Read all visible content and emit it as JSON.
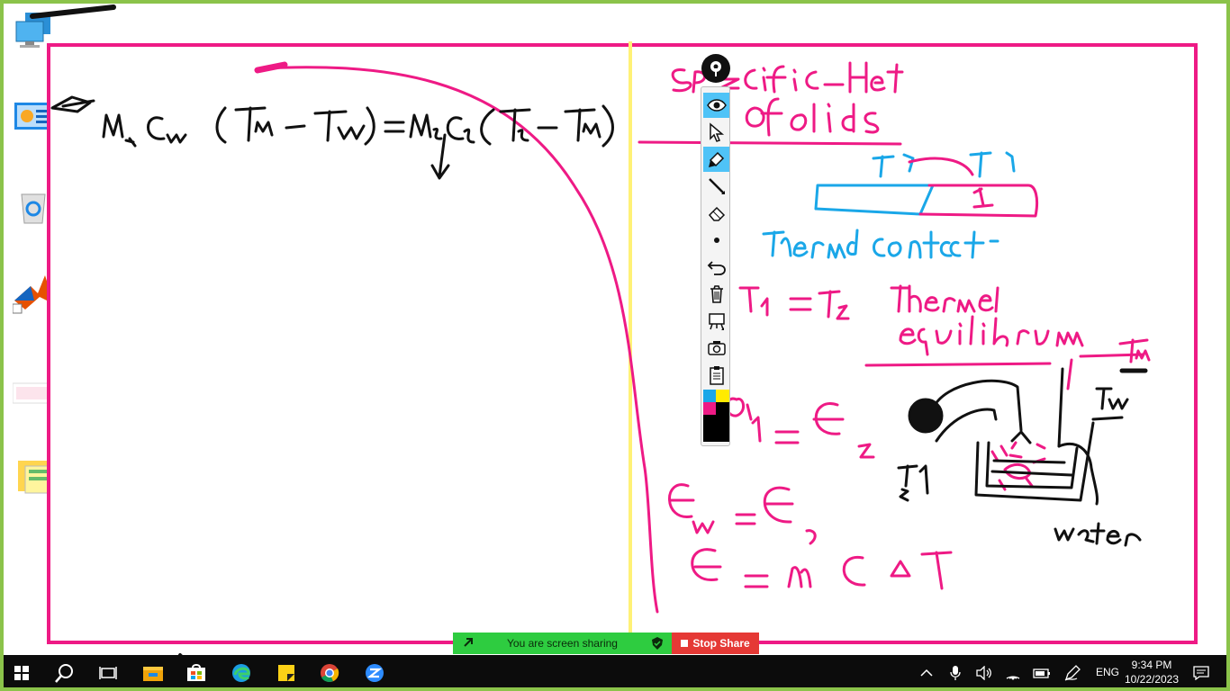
{
  "toolbar": {
    "tools": [
      "pin-icon",
      "eye-icon",
      "pointer-icon",
      "highlighter-icon",
      "line-icon",
      "eraser-icon",
      "dot-icon",
      "undo-icon",
      "trash-icon",
      "whiteboard-icon",
      "camera-icon",
      "clipboard-icon",
      "color-palette-icon"
    ],
    "colors": [
      "#1aa7e8",
      "#ffeb00",
      "#ee1a85",
      "#000000"
    ]
  },
  "share_bar": {
    "status_text": "You are screen sharing",
    "stop_label": "Stop Share",
    "status_color": "#2ecc40",
    "stop_color": "#e53935"
  },
  "taskbar": {
    "icons": [
      "windows-start-icon",
      "search-icon",
      "task-view-icon",
      "file-explorer-icon",
      "store-icon",
      "edge-icon",
      "sticky-notes-icon",
      "chrome-icon",
      "zoom-icon"
    ],
    "tray_icons": [
      "chevron-up-icon",
      "microphone-icon",
      "volume-icon",
      "wifi-icon",
      "battery-icon",
      "pen-icon"
    ],
    "language": "ENG",
    "time": "9:34 PM",
    "date": "10/22/2023"
  },
  "colors": {
    "ink_pink": "#ee1a85",
    "ink_blue": "#1aa7e8",
    "ink_black": "#111111",
    "frame_green": "#8bc34a",
    "divider_yellow": "#fff176"
  }
}
